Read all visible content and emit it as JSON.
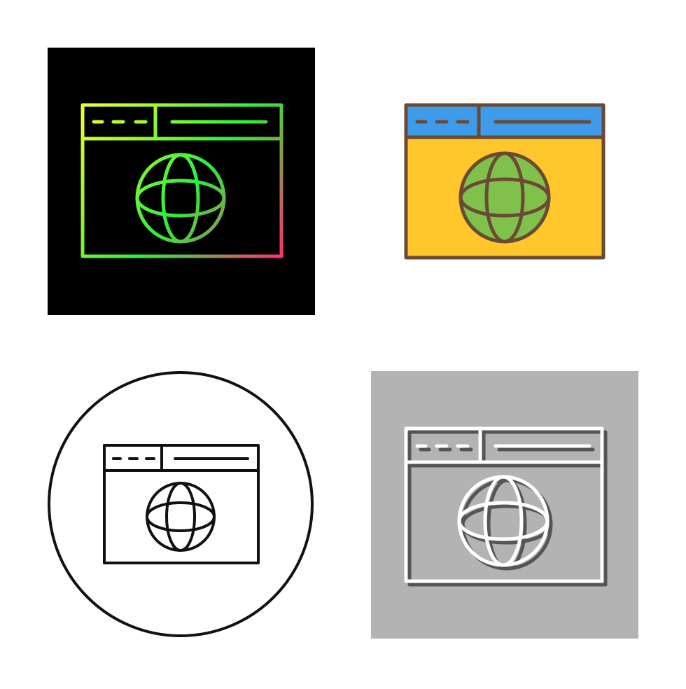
{
  "icons": [
    {
      "name": "web-browser-gradient-icon",
      "style": "gradient line on dark tile",
      "colors": {
        "background": "#000000",
        "gradient_start": "#f2ff2a",
        "gradient_mid": "#2cf03a",
        "gradient_end": "#ff2d6e"
      }
    },
    {
      "name": "web-browser-flat-color-icon",
      "style": "filled color",
      "colors": {
        "titlebar": "#3d9bea",
        "body": "#ffc72c",
        "globe": "#80c14b",
        "stroke": "#6b4a35"
      }
    },
    {
      "name": "web-browser-outline-circle-icon",
      "style": "black outline in circle",
      "colors": {
        "stroke": "#111111",
        "background": "#ffffff"
      }
    },
    {
      "name": "web-browser-gray-glyph-icon",
      "style": "white line on gray tile with shadow",
      "colors": {
        "background": "#b3b3b3",
        "stroke": "#ffffff",
        "shadow": "#555555"
      }
    }
  ]
}
